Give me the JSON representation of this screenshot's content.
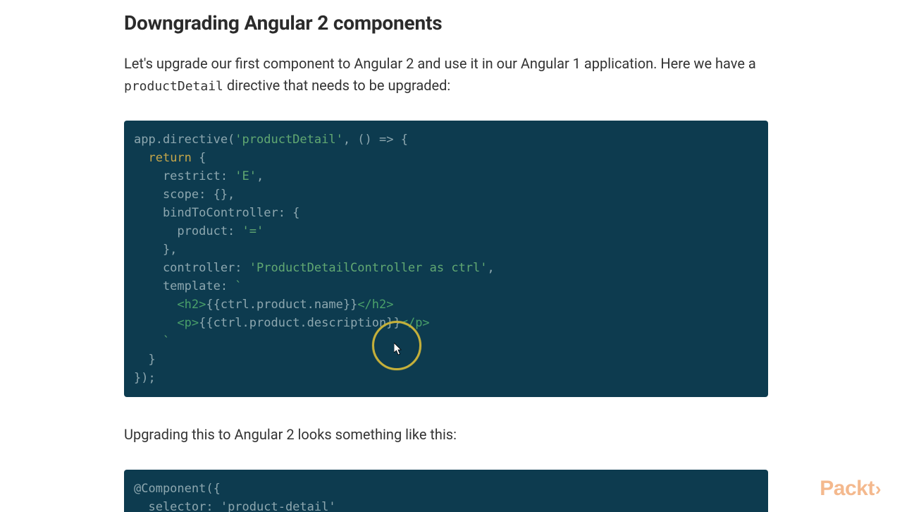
{
  "heading": "Downgrading Angular 2 components",
  "para1_a": "Let's upgrade our first component to Angular 2 and use it in our Angular 1 application. Here we have a ",
  "para1_code": "productDetail",
  "para1_b": " directive that needs to be upgraded:",
  "code1": {
    "l1a": "app.directive(",
    "l1s": "'productDetail'",
    "l1b": ", () => {",
    "l2a": "  ",
    "l2k": "return",
    "l2b": " {",
    "l3a": "    restrict: ",
    "l3s": "'E'",
    "l3b": ",",
    "l4": "    scope: {},",
    "l5": "    bindToController: {",
    "l6a": "      product: ",
    "l6s": "'='",
    "l7": "    },",
    "l8a": "    controller: ",
    "l8s": "'ProductDetailController as ctrl'",
    "l8b": ",",
    "l9a": "    template: ",
    "l9s": "`",
    "l10a": "      ",
    "l10t1": "<h2>",
    "l10m": "{{ctrl.product.name}}",
    "l10t2": "</h2>",
    "l11a": "      ",
    "l11t1": "<p>",
    "l11m": "{{ctrl.product.description}}",
    "l11t2": "</p>",
    "l12a": "    ",
    "l12s": "`",
    "l13": "  }",
    "l14": "});"
  },
  "para2": "Upgrading this to Angular 2 looks something like this:",
  "code2": {
    "l1": "@Component({",
    "l2a": "  selector: ",
    "l2s": "'product-detail'"
  },
  "logo_text": "Packt",
  "logo_arrow": "›"
}
